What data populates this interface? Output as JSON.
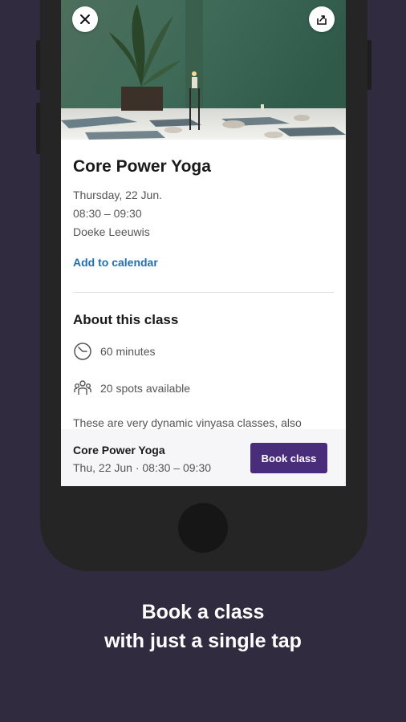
{
  "class": {
    "title": "Core Power Yoga",
    "date": "Thursday, 22 Jun.",
    "time": "08:30 – 09:30",
    "teacher": "Doeke Leeuwis",
    "add_to_calendar": "Add to calendar"
  },
  "about": {
    "title": "About this class",
    "duration": "60 minutes",
    "spots": "20 spots available",
    "description": "These are very dynamic vinyasa classes, also"
  },
  "booking_bar": {
    "title": "Core Power Yoga",
    "subtitle": "Thu, 22 Jun · 08:30 – 09:30",
    "book_label": "Book class"
  },
  "caption": {
    "line1": "Book a class",
    "line2": "with just a single tap"
  },
  "icons": {
    "close": "close-icon",
    "share": "share-icon",
    "clock": "clock-icon",
    "people": "people-icon"
  },
  "colors": {
    "background": "#312b40",
    "accent": "#4a2d7a",
    "link": "#1e6fb3"
  }
}
